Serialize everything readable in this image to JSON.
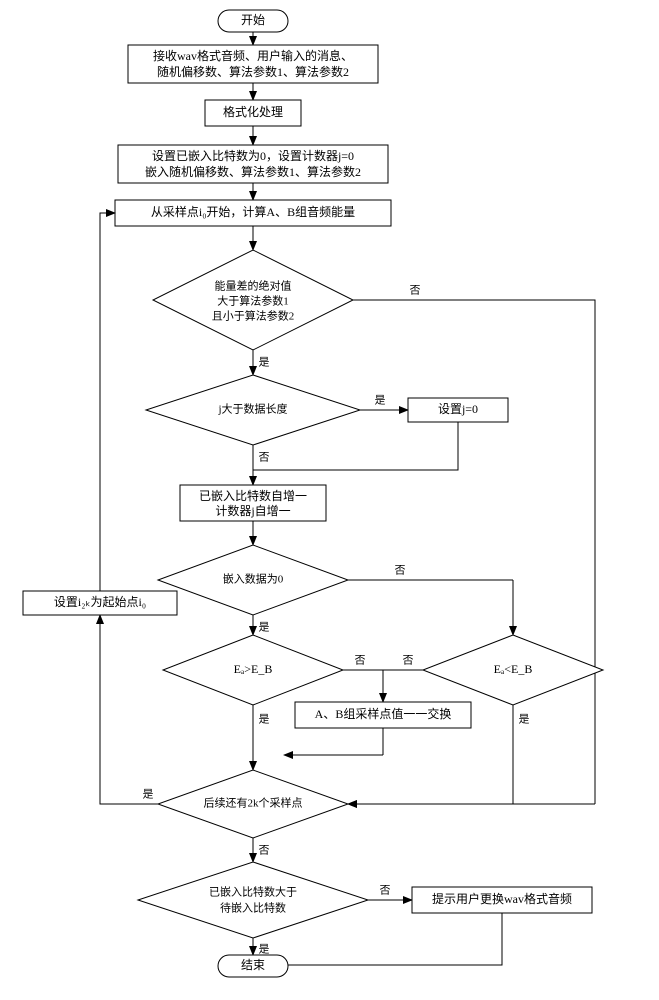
{
  "flowchart": {
    "start": "开始",
    "end": "结束",
    "steps": {
      "receive": {
        "line1": "接收wav格式音频、用户输入的消息、",
        "line2": "随机偏移数、算法参数1、算法参数2"
      },
      "format": "格式化处理",
      "init": {
        "line1": "设置已嵌入比特数为0，设置计数器j=0",
        "line2": "嵌入随机偏移数、算法参数1、算法参数2"
      },
      "compute": "从采样点i₀开始，计算A、B组音频能量",
      "energy_diff": {
        "line1": "能量差的绝对值",
        "line2": "大于算法参数1",
        "line3": "且小于算法参数2"
      },
      "j_gt_len": "j大于数据长度",
      "set_j0": "设置j=0",
      "increment": {
        "line1": "已嵌入比特数自增一",
        "line2": "计数器j自增一"
      },
      "embed_zero": "嵌入数据为0",
      "ea_gt_eb": "Eₐ>E_B",
      "ea_lt_eb": "Eₐ<E_B",
      "swap": "A、B组采样点值一一交换",
      "has_2k": "后续还有2k个采样点",
      "embedded_gt": {
        "line1": "已嵌入比特数大于",
        "line2": "待嵌入比特数"
      },
      "prompt": "提示用户更换wav格式音频",
      "set_i2k": "设置i₂ₖ为起始点i₀"
    },
    "labels": {
      "yes": "是",
      "no": "否"
    }
  }
}
